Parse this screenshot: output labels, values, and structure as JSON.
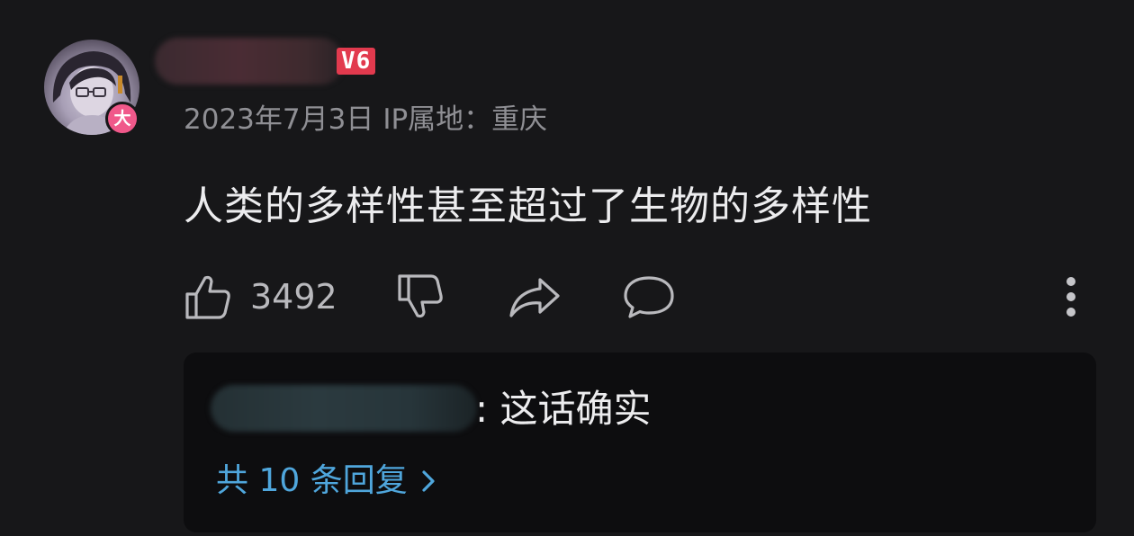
{
  "comment": {
    "avatar_badge": "大",
    "level_badge": "V6",
    "date": "2023年7月3日",
    "ip_location": "IP属地：重庆",
    "text": "人类的多样性甚至超过了生物的多样性",
    "like_count": "3492"
  },
  "reply_preview": {
    "text": ": 这话确实",
    "more_replies_label": "共 10 条回复"
  },
  "colors": {
    "background": "#171719",
    "reply_box": "#0d0d0f",
    "link": "#4fa6dc",
    "level_badge": "#e23a4e",
    "avatar_badge": "#f0588a"
  },
  "icons": {
    "like": "thumbs-up-icon",
    "dislike": "thumbs-down-icon",
    "share": "share-arrow-icon",
    "reply": "comment-bubble-icon",
    "more": "vertical-dots-icon",
    "expand": "chevron-right-icon"
  }
}
